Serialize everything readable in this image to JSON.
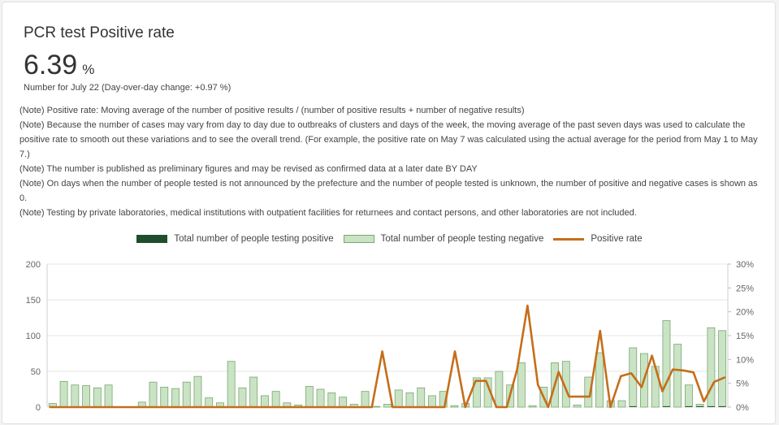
{
  "card": {
    "title": "PCR test Positive rate",
    "value": "6.39",
    "unit": "%",
    "subtitle": "Number for July 22  (Day-over-day change: +0.97 %)"
  },
  "notes": [
    "(Note) Positive rate: Moving average of the number of positive results / (number of positive results + number of negative results)",
    "(Note) Because the number of cases may vary from day to day due to outbreaks of clusters and days of the week, the moving average of the past seven days was used to calculate the positive rate to smooth out these variations and to see the overall trend. (For example, the positive rate on May 7 was calculated using the actual average for the period from May 1 to May 7.)",
    "(Note) The number is published as preliminary figures and may be revised as confirmed data at a later date BY DAY",
    "(Note) On days when the number of people tested is not announced by the prefecture and the number of people tested is unknown, the number of positive and negative cases is shown as 0.",
    "(Note) Testing by private laboratories, medical institutions with outpatient facilities for returnees and contact persons, and other laboratories are not included."
  ],
  "legend": {
    "positive": "Total number of people testing positive",
    "negative": "Total number of people testing negative",
    "rate": "Positive rate"
  },
  "colors": {
    "positive": "#1f4e2c",
    "negative": "#c9e3c4",
    "negative_border": "#7aa86f",
    "rate": "#c56e1a"
  },
  "chart_data": {
    "type": "bar",
    "stacked": true,
    "y_left_ticks": [
      "200",
      "150",
      "100",
      "50",
      "0"
    ],
    "y_right_ticks": [
      "30%",
      "25%",
      "20%",
      "15%",
      "10%",
      "5%",
      "0%"
    ],
    "ylim_left": [
      0,
      200
    ],
    "ylim_right": [
      0,
      30
    ],
    "series": [
      {
        "name": "Total number of people testing positive",
        "values": [
          0,
          0,
          0,
          0,
          0,
          0,
          0,
          0,
          0,
          0,
          0,
          0,
          0,
          0,
          0,
          0,
          0,
          0,
          0,
          0,
          0,
          0,
          0,
          0,
          0,
          0,
          0,
          0,
          0,
          0,
          0,
          0,
          0,
          0,
          0,
          0,
          0,
          0,
          0,
          0,
          0,
          0,
          0,
          0,
          0,
          0,
          0,
          0,
          0,
          0,
          0,
          0,
          1,
          0,
          0,
          1,
          0,
          1,
          1,
          1,
          1,
          1,
          2,
          2,
          1,
          2,
          1,
          2,
          1,
          2,
          1,
          5,
          1,
          1,
          1,
          2,
          3,
          4,
          3,
          4,
          4,
          4,
          3,
          3,
          2,
          3
        ]
      },
      {
        "name": "Total number of people testing negative",
        "values": [
          5,
          36,
          31,
          30,
          27,
          31,
          0,
          0,
          7,
          35,
          28,
          26,
          35,
          43,
          13,
          6,
          64,
          27,
          42,
          16,
          22,
          6,
          3,
          29,
          25,
          20,
          14,
          4,
          22,
          1,
          4,
          24,
          20,
          27,
          16,
          22,
          2,
          5,
          41,
          41,
          50,
          31,
          62,
          2,
          28,
          62,
          64,
          3,
          42,
          76,
          9,
          9,
          82,
          75,
          57,
          120,
          88,
          30,
          3,
          110,
          106
        ]
      },
      {
        "name": "Positive rate",
        "values": [
          0,
          0,
          0,
          0,
          0,
          0,
          0,
          0,
          0,
          0,
          0,
          0,
          0,
          0,
          0,
          0,
          0,
          0,
          0,
          0,
          0,
          0,
          0,
          0,
          0,
          0,
          0,
          0,
          0,
          0,
          0,
          0,
          11.7,
          0,
          0,
          0,
          0,
          0,
          0,
          11.7,
          0,
          5.5,
          5.5,
          0,
          0,
          7.9,
          21.3,
          4.7,
          0,
          7.4,
          2.2,
          2.2,
          2.2,
          16,
          0,
          6.5,
          7.1,
          4.2,
          10.8,
          3.3,
          7.9,
          7.7,
          7.3,
          1.2,
          5.3,
          6.2
        ]
      }
    ]
  }
}
